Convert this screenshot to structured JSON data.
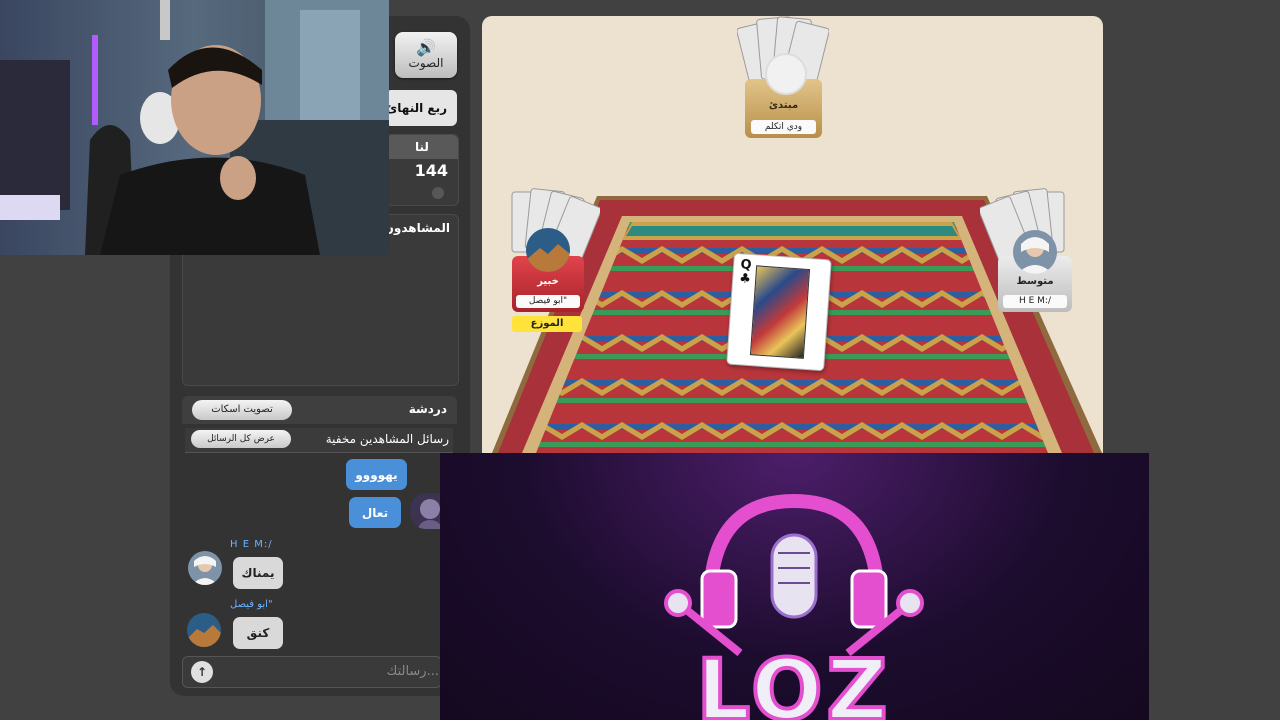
{
  "sound_button": {
    "label": "الصوت",
    "icon": "speaker-icon"
  },
  "round_label": "ربع النهائ",
  "score": {
    "label": "لنا",
    "value": "144"
  },
  "viewers_title": "المشاهدون",
  "chat": {
    "title": "دردشة",
    "mute_vote_button": "تصويت اسكات",
    "hidden_notice": "رسائل المشاهدين مخفية",
    "show_all_button": "عرض كل الرسائل",
    "messages": [
      {
        "text": "يهوووو"
      },
      {
        "text": "تعال"
      },
      {
        "sender": "H E M:/",
        "text": "يمناك"
      },
      {
        "sender": "ابو فيصل\"",
        "text": "كنق"
      }
    ],
    "input_placeholder": "رسالتك...",
    "send_icon": "arrow-up-icon"
  },
  "players": {
    "top": {
      "level": "مبتدئ",
      "name": "ودي اتكلم"
    },
    "left": {
      "level": "خبير",
      "name": "ابو فيصل\"",
      "role": "الموزع"
    },
    "right": {
      "level": "متوسط",
      "name": "H E M:/"
    }
  },
  "played_card": {
    "rank": "Q",
    "suit": "♣"
  },
  "overlay": {
    "logo_text": "LOZ"
  },
  "colors": {
    "chat_blue": "#4a90d9",
    "sender_blue": "#6bb3ff",
    "panel": "#333333",
    "board_bg": "#ece2cf",
    "logo_pink": "#e44fd0"
  }
}
